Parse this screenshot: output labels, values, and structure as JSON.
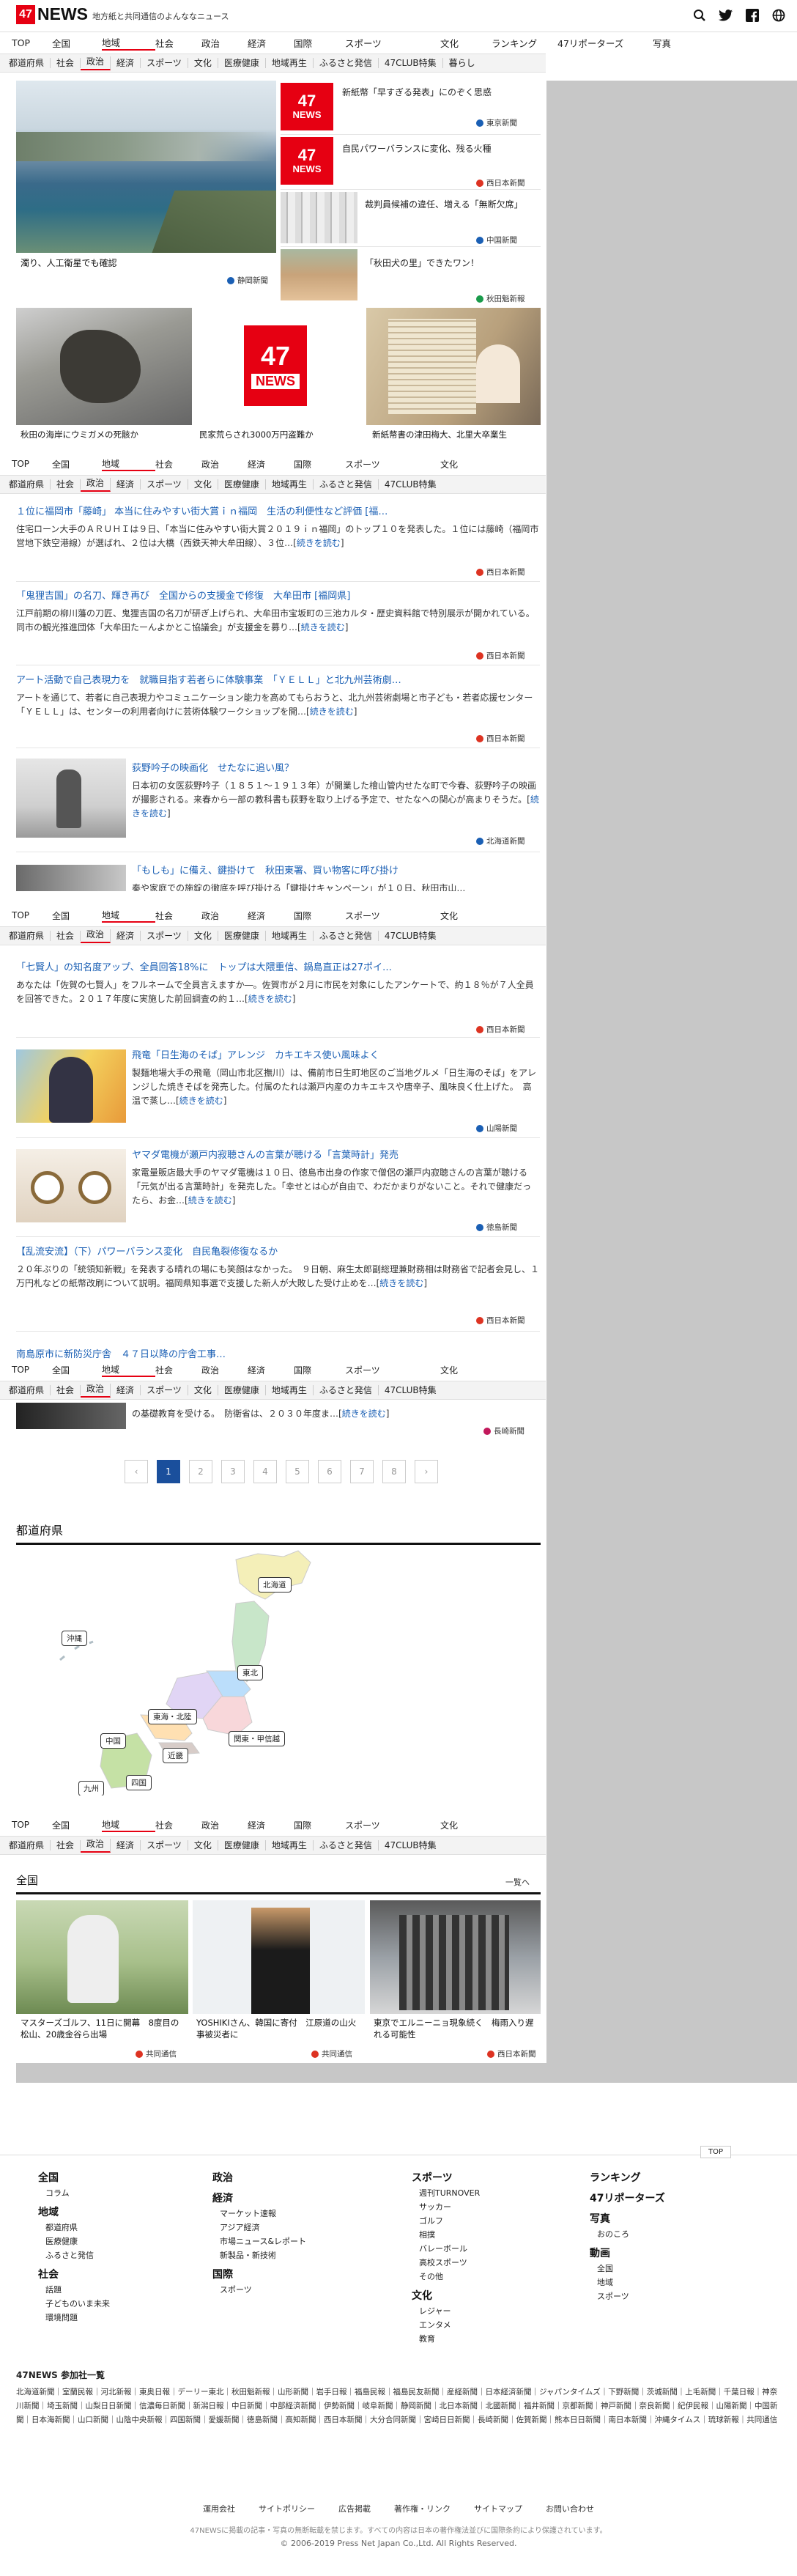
{
  "header": {
    "logo_num": "47",
    "logo_text": "NEWS",
    "tagline": "地方紙と共同通信のよんななニュース"
  },
  "nav_main": [
    "TOP",
    "全国",
    "地域",
    "社会",
    "政治",
    "経済",
    "国際",
    "スポーツ",
    "文化",
    "ランキング",
    "47リポーターズ",
    "写真"
  ],
  "nav_region": [
    "都道府県",
    "社会",
    "政治",
    "経済",
    "スポーツ",
    "文化",
    "医療健康",
    "地域再生",
    "ふるさと発信",
    "47CLUB特集",
    "暮らし"
  ],
  "nav_main_short": [
    "TOP",
    "全国",
    "地域",
    "社会",
    "政治",
    "経済",
    "国際",
    "スポーツ",
    "文化"
  ],
  "top": {
    "main_caption": "濁り、人工衛星でも確認",
    "main_source": "静岡新聞",
    "right_items": [
      {
        "title": "新紙幣「早すぎる発表」にのぞく思惑",
        "source": "東京新聞"
      },
      {
        "title": "自民パワーバランスに変化、残る火種",
        "source": "西日本新聞"
      },
      {
        "title": "裁判員候補の違任、増える「無断欠席」",
        "source": "中国新聞"
      },
      {
        "title": "「秋田犬の里」できたワン！",
        "source": "秋田魁新報"
      }
    ],
    "bottom_items": [
      {
        "caption": "秋田の海岸にウミガメの死骸か"
      },
      {
        "caption": "民家荒らされ3000万円盗難か"
      },
      {
        "caption": "新紙幣書の津田梅大、北里大卒業生"
      }
    ]
  },
  "articles_1": [
    {
      "title": "１位に福岡市「藤崎」 本当に住みやすい街大賞ｉｎ福岡　生活の利便性など評価 [福…",
      "body": "住宅ローン大手のＡＲＵＨＩは９日、「本当に住みやすい街大賞２０１９ｉｎ福岡」のトップ１０を発表した。１位には藤崎（福岡市営地下鉄空港線）が選ばれ、２位は大橋（西鉄天神大牟田線）、３位…",
      "more": "続きを読む",
      "source": "西日本新聞"
    },
    {
      "title": "「鬼狸吉国」の名刀、輝き再び　全国からの支援金で修復　大牟田市 [福岡県]",
      "body": "江戸前期の柳川藩の刀匠、鬼狸吉国の名刀が研ぎ上げられ、大牟田市宝坂町の三池カルタ・歴史資料館で特別展示が開かれている。同市の観光推進団体「大牟田たーんよかとこ協議会」が支援金を募り…",
      "more": "続きを読む",
      "source": "西日本新聞"
    },
    {
      "title": "アート活動で自己表現力を　就職目指す若者らに体験事業　「ＹＥＬＬ」と北九州芸術劇…",
      "body": "アートを通じて、若者に自己表現力やコミュニケーション能力を高めてもらおうと、北九州芸術劇場と市子ども・若者応援センター「ＹＥＬＬ」は、センターの利用者向けに芸術体験ワークショップを開…",
      "more": "続きを読む",
      "source": "西日本新聞"
    },
    {
      "title": "荻野吟子の映画化　せたなに追い風？",
      "body": "日本初の女医荻野吟子（１８５１～１９１３年）が開業した檜山管内せたな町で今春、荻野吟子の映画が撮影される。来春から一部の教科書も荻野を取り上げる予定で、せたなへの関心が高まりそうだ。",
      "more": "続きを読む",
      "source": "北海道新聞"
    },
    {
      "title": "「もしも」に備え、鍵掛けて　秋田東署、買い物客に呼び掛け",
      "body": "秦や家庭での施錠の徹底を呼び掛ける「鍵掛けキャンペーン」が１０日、秋田市山…"
    }
  ],
  "articles_2": [
    {
      "title": "「七賢人」の知名度アップ、全員回答18%に　トップは大隈重信、鍋島直正は27ポイ…",
      "body": "あなたは「佐賀の七賢人」をフルネームで全員言えますか―。佐賀市が２月に市民を対象にしたアンケートで、約１８％が７人全員を回答できた。２０１７年度に実施した前回調査の約１…",
      "more": "続きを読む",
      "source": "西日本新聞"
    },
    {
      "title": "飛竜「日生海のそば」アレンジ　カキエキス使い風味よく",
      "body": "製麺地場大手の飛竜（岡山市北区撫川）は、備前市日生町地区のご当地グルメ「日生海のそば」をアレンジした焼きそばを発売した。付属のたれは瀬戸内産のカキエキスや唐辛子、風味良く仕上げた。　高温で蒸し…",
      "more": "続きを読む",
      "source": "山陽新聞"
    },
    {
      "title": "ヤマダ電機が瀬戸内寂聴さんの言葉が聴ける「言葉時計」発売",
      "body": "家電量販店最大手のヤマダ電機は１０日、徳島市出身の作家で僧侶の瀬戸内寂聴さんの言葉が聴ける「元気が出る言葉時計」を発売した。「幸せとは心が自由で、わだかまりがないこと。それで健康だったら、お金…",
      "more": "続きを読む",
      "source": "徳島新聞"
    },
    {
      "title": "【乱流安流】（下）パワーバランス変化　自民亀裂修復なるか",
      "body": "２０年ぶりの「統領知新戦」を発表する晴れの場にも笑顔はなかった。　９日朝、麻生太郎副総理兼財務相は財務省で記者会見し、１万円札などの紙幣改刷について説明。福岡県知事選で支援した新人が大敗した受け止めを…",
      "more": "続きを読む",
      "source": "西日本新聞"
    },
    {
      "title": "南島原市に新防災庁舎　４７日以降の庁舎工事…",
      "body": "の基礎教育を受ける。　防衛省は、２０３０年度ま…",
      "more": "続きを読む",
      "source": "長崎新聞"
    }
  ],
  "pagination": [
    "‹",
    "1",
    "2",
    "3",
    "4",
    "5",
    "6",
    "7",
    "8",
    "›"
  ],
  "prefecture_section": {
    "title": "都道府県",
    "regions": [
      "北海道",
      "沖縄",
      "東北",
      "東海・北陸",
      "関東・甲信越",
      "中国",
      "近畿",
      "四国",
      "九州"
    ]
  },
  "national_section": {
    "title": "全国",
    "more": "一覧へ",
    "items": [
      {
        "caption": "マスターズゴルフ、11日に開幕　8度目の松山、20歳金谷ら出場",
        "source": "共同通信"
      },
      {
        "caption": "YOSHIKIさん、韓国に寄付　江原道の山火事被災者に",
        "source": "共同通信"
      },
      {
        "caption": "東京でエルニーニョ現象続く　梅雨入り遅れる可能性",
        "source": "西日本新聞"
      }
    ]
  },
  "footer": {
    "top_link": "TOP",
    "col1": [
      {
        "h": "全国"
      },
      {
        "s": "コラム"
      },
      {
        "h": "地域"
      },
      {
        "s": "都道府県"
      },
      {
        "s": "医療健康"
      },
      {
        "s": "ふるさと発信"
      },
      {
        "h": "社会"
      },
      {
        "s": "話題"
      },
      {
        "s": "子どものいま未来"
      },
      {
        "s": "環境問題"
      }
    ],
    "col2": [
      {
        "h": "政治"
      },
      {
        "h": "経済"
      },
      {
        "s": "マーケット速報"
      },
      {
        "s": "アジア経済"
      },
      {
        "s": "市場ニュース&レポート"
      },
      {
        "s": "新製品・新技術"
      },
      {
        "h": "国際"
      },
      {
        "s": "スポーツ"
      }
    ],
    "col3": [
      {
        "h": "スポーツ"
      },
      {
        "s": "週刊TURNOVER"
      },
      {
        "s": "サッカー"
      },
      {
        "s": "ゴルフ"
      },
      {
        "s": "相撲"
      },
      {
        "s": "バレーボール"
      },
      {
        "s": "高校スポーツ"
      },
      {
        "s": "その他"
      },
      {
        "h": "文化"
      },
      {
        "s": "レジャー"
      },
      {
        "s": "エンタメ"
      },
      {
        "s": "教育"
      }
    ],
    "col4": [
      {
        "h": "ランキング"
      },
      {
        "h": "47リポーターズ"
      },
      {
        "h": "写真"
      },
      {
        "s": "おのころ"
      },
      {
        "h": "動画"
      },
      {
        "s": "全国"
      },
      {
        "s": "地域"
      },
      {
        "s": "スポーツ"
      }
    ],
    "partners_title": "47NEWS 参加社一覧",
    "partners": "北海道新聞｜室蘭民報｜河北新報｜東奥日報｜デーリー東北｜秋田魁新報｜山形新聞｜岩手日報｜福島民報｜福島民友新聞｜産経新聞｜日本経済新聞｜ジャパンタイムズ｜下野新聞｜茨城新聞｜上毛新聞｜千葉日報｜神奈川新聞｜埼玉新聞｜山梨日日新聞｜信濃毎日新聞｜新潟日報｜中日新聞｜中部経済新聞｜伊勢新聞｜岐阜新聞｜静岡新聞｜北日本新聞｜北國新聞｜福井新聞｜京都新聞｜神戸新聞｜奈良新聞｜紀伊民報｜山陽新聞｜中国新聞｜日本海新聞｜山口新聞｜山陰中央新報｜四国新聞｜愛媛新聞｜徳島新聞｜高知新聞｜西日本新聞｜大分合同新聞｜宮崎日日新聞｜長崎新聞｜佐賀新聞｜熊本日日新聞｜南日本新聞｜沖縄タイムス｜琉球新報｜共同通信",
    "links": [
      "運用会社",
      "サイトポリシー",
      "広告掲載",
      "著作権・リンク",
      "サイトマップ",
      "お問い合わせ"
    ],
    "notice": "47NEWSに掲載の記事・写真の無断転載を禁じます。すべての内容は日本の著作権法並びに国際条約により保護されています。",
    "copyright": "© 2006-2019 Press Net Japan Co.,Ltd. All Rights Reserved."
  }
}
